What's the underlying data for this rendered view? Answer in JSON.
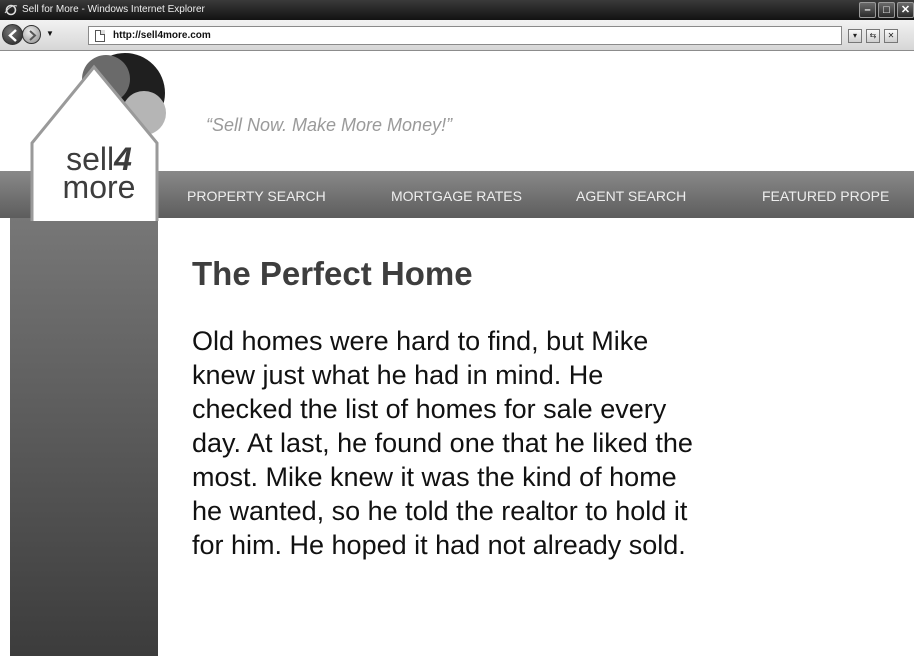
{
  "window": {
    "title": "Sell for More - Windows Internet Explorer",
    "controls": {
      "minimize": "–",
      "maximize": "□",
      "close": "✕"
    }
  },
  "addressbar": {
    "url": "http://sell4more.com",
    "dropdown_icon": "▾",
    "refresh_icon": "⇆",
    "stop_icon": "✕"
  },
  "site": {
    "logo": {
      "word1": "sell",
      "number": "4",
      "word2": "more"
    },
    "tagline": "“Sell Now. Make More Money!”",
    "nav": [
      {
        "label": "PROPERTY SEARCH"
      },
      {
        "label": "MORTGAGE RATES"
      },
      {
        "label": "AGENT SEARCH"
      },
      {
        "label": "FEATURED PROPE"
      }
    ]
  },
  "article": {
    "heading": "The Perfect Home",
    "lines": [
      "Old homes were hard to find, but Mike",
      "knew just what he had in mind. He",
      "checked the list of homes for sale every",
      "day. At last, he found one that he liked the",
      "most. Mike knew it was the kind of home",
      "he wanted, so he told the realtor to hold it",
      "for him. He hoped it had not already sold."
    ]
  },
  "colors": {
    "titlebar": "#1e1e1e",
    "navbar": "#6f6f6f",
    "tagline": "#9a9a9a",
    "heading": "#3e3e3e"
  }
}
